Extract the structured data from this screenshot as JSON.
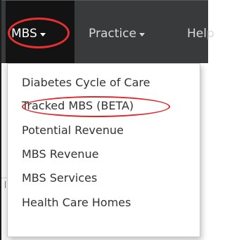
{
  "navbar": {
    "items": [
      {
        "label": "MBS",
        "active": true
      },
      {
        "label": "Practice",
        "active": false
      },
      {
        "label": "Help",
        "active": false
      }
    ]
  },
  "mbs_menu": {
    "items": [
      {
        "label": "Diabetes Cycle of Care"
      },
      {
        "label": "Tracked MBS (BETA)",
        "highlighted": true
      },
      {
        "label": "Potential Revenue"
      },
      {
        "label": "MBS Revenue"
      },
      {
        "label": "MBS Services"
      },
      {
        "label": "Health Care Homes"
      }
    ]
  },
  "colors": {
    "navbar_bg": "#383a3c",
    "navbar_active_bg": "#131313",
    "annotation_red": "#e53030",
    "menu_text": "#333333"
  },
  "icons": {
    "dropdown_indicator": "caret-down-icon"
  }
}
